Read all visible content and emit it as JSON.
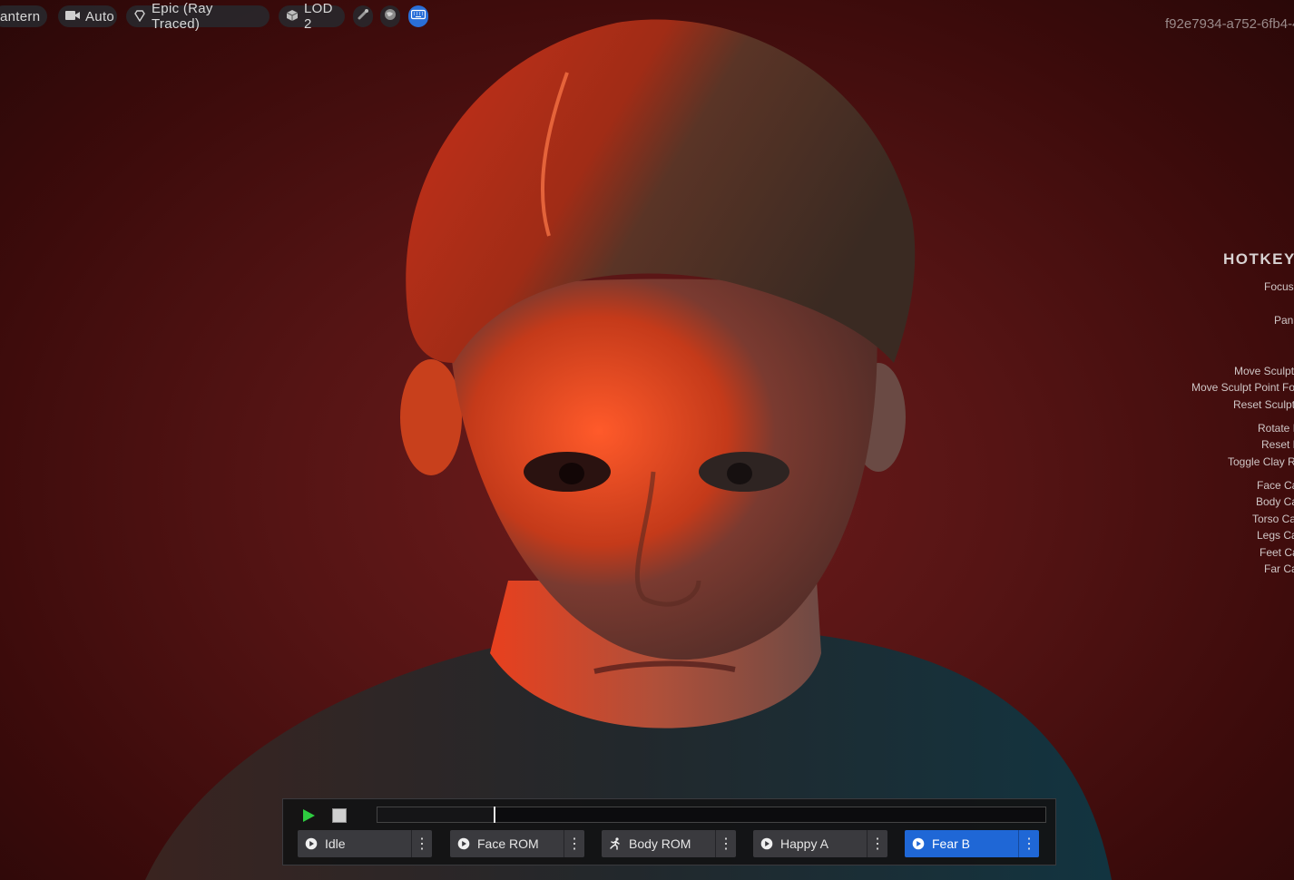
{
  "toolbar": {
    "lantern_label": "antern",
    "camera_label": "Auto",
    "quality_label": "Epic (Ray Traced)",
    "lod_label": "LOD 2",
    "icons": [
      "lantern-icon",
      "camera-icon",
      "diamond-icon",
      "cube-icon",
      "joint-icon",
      "globe-icon",
      "keyboard-icon"
    ]
  },
  "guid": "f92e7934-a752-6fb4-4",
  "hotkeys": {
    "title": "HOTKEY F",
    "items": [
      "Focus",
      "Pan",
      "Move Sculpt",
      "Move Sculpt Point Fo",
      "Reset Sculpt",
      "Rotate L",
      "Reset L",
      "Toggle Clay R",
      "Face Ca",
      "Body Ca",
      "Torso Ca",
      "Legs Ca",
      "Feet Ca",
      "Far Ca"
    ]
  },
  "timeline": {
    "progress": 0.175,
    "animations": [
      {
        "label": "Idle",
        "icon": "play-circle-icon",
        "selected": false
      },
      {
        "label": "Face ROM",
        "icon": "play-circle-icon",
        "selected": false
      },
      {
        "label": "Body ROM",
        "icon": "running-figure-icon",
        "selected": false
      },
      {
        "label": "Happy A",
        "icon": "play-circle-icon",
        "selected": false
      },
      {
        "label": "Fear B",
        "icon": "play-circle-icon",
        "selected": true
      }
    ],
    "menu_glyph": "⋮"
  },
  "colors": {
    "background": "#551414",
    "accent_blue": "#1f67d6",
    "play_green": "#2ecc40"
  }
}
